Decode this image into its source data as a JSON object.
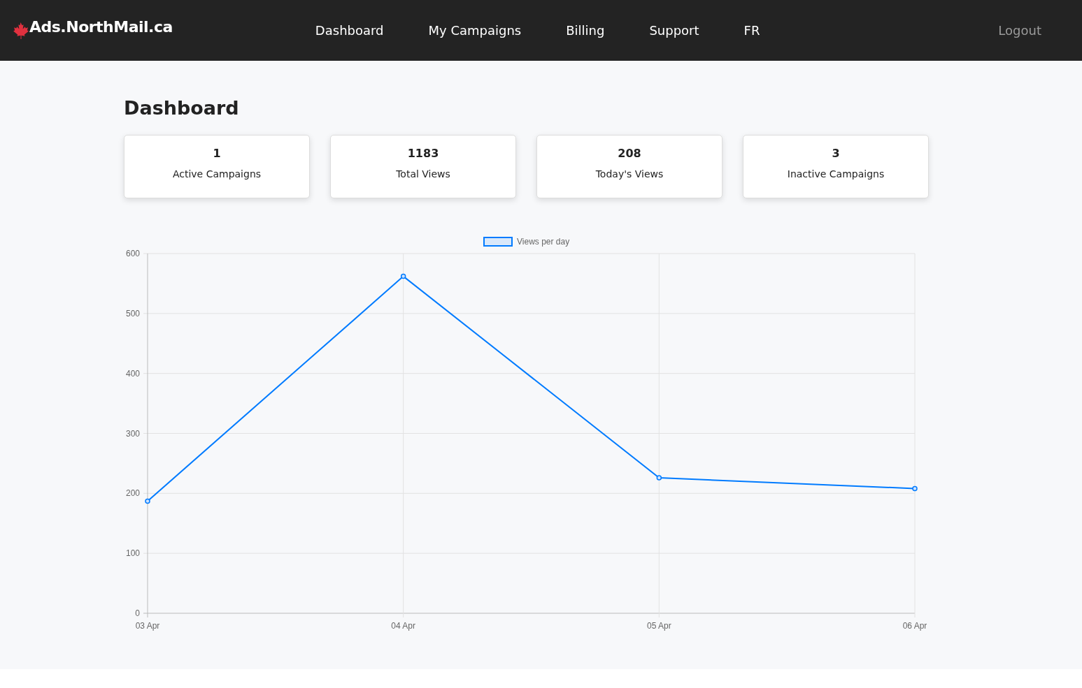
{
  "brand": "Ads.NorthMail.ca",
  "nav": [
    "Dashboard",
    "My Campaigns",
    "Billing",
    "Support",
    "FR"
  ],
  "logout": "Logout",
  "title": "Dashboard",
  "stats": [
    {
      "value": "1",
      "label": "Active Campaigns"
    },
    {
      "value": "1183",
      "label": "Total Views"
    },
    {
      "value": "208",
      "label": "Today's Views"
    },
    {
      "value": "3",
      "label": "Inactive Campaigns"
    }
  ],
  "chart_data": {
    "type": "line",
    "categories": [
      "03 Apr",
      "04 Apr",
      "05 Apr",
      "06 Apr"
    ],
    "series": [
      {
        "name": "Views per day",
        "color": "#007bff",
        "marker": "circle",
        "values": [
          187,
          562,
          226,
          208
        ]
      }
    ],
    "grid": true,
    "ylim": [
      0,
      600
    ],
    "yticks": [
      0,
      100,
      200,
      300,
      400,
      500,
      600
    ]
  }
}
